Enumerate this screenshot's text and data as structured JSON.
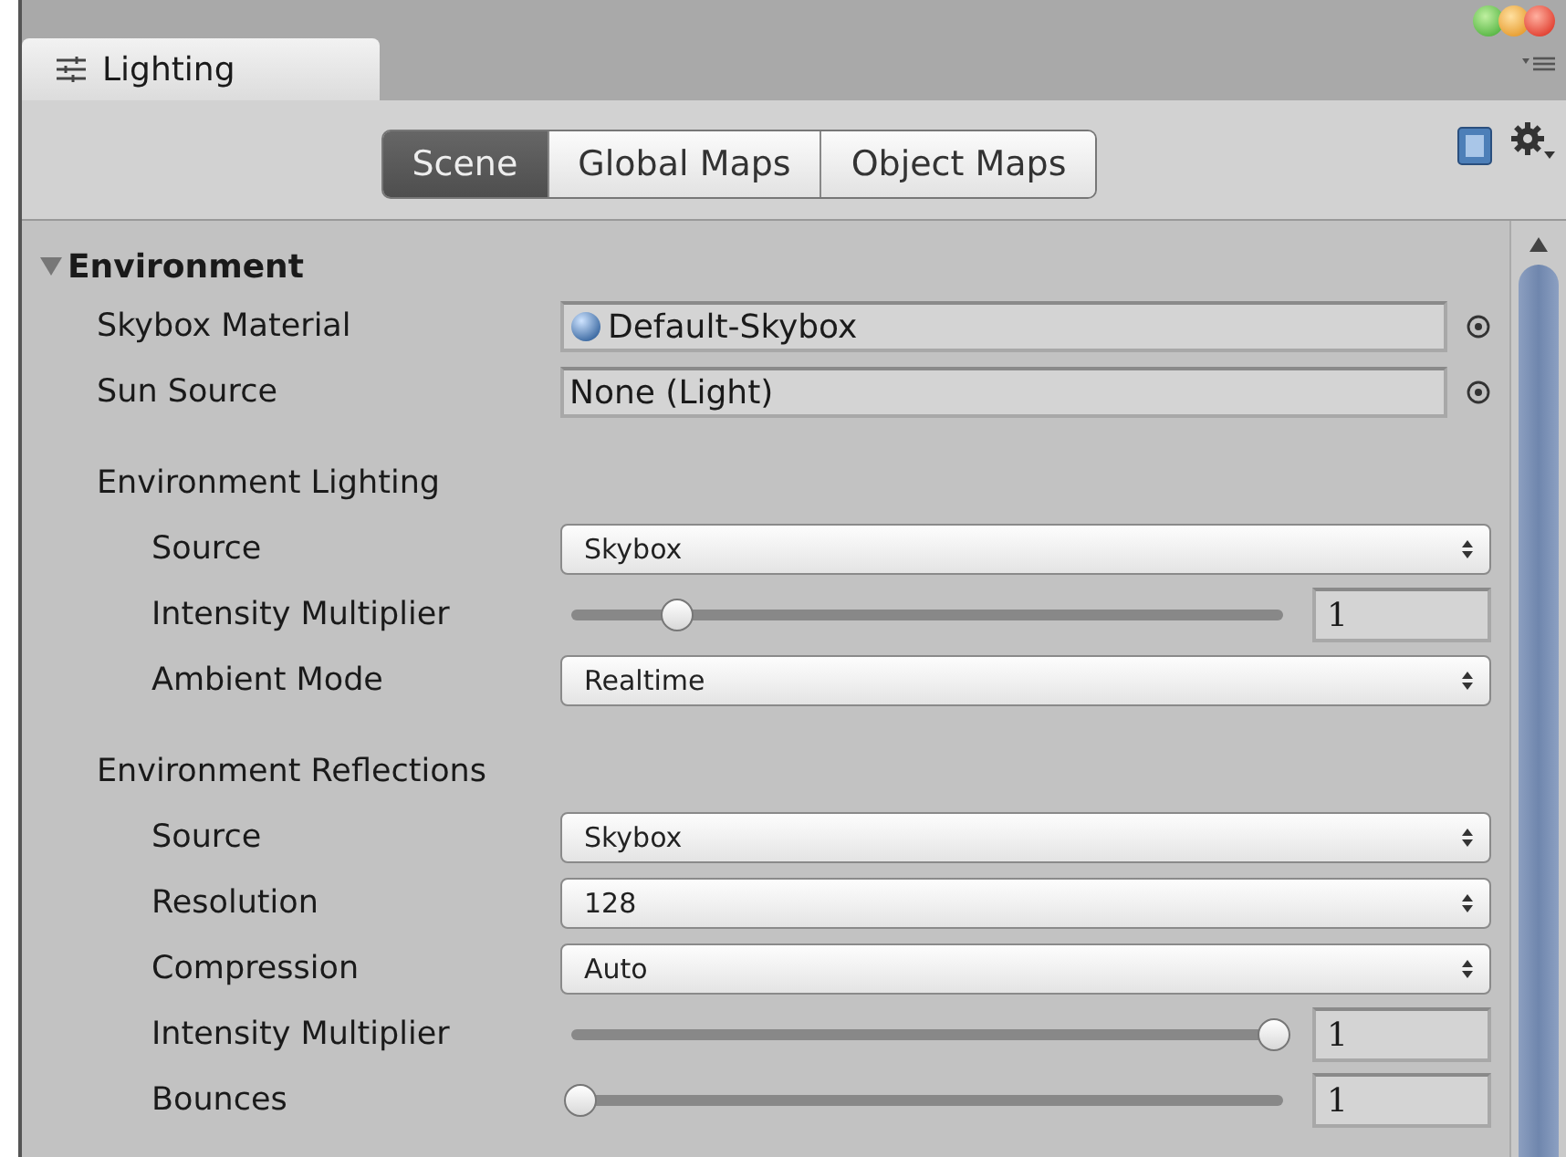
{
  "window": {
    "tab_title": "Lighting"
  },
  "toolbar": {
    "tabs": [
      {
        "label": "Scene",
        "selected": true
      },
      {
        "label": "Global Maps",
        "selected": false
      },
      {
        "label": "Object Maps",
        "selected": false
      }
    ]
  },
  "section": {
    "title": "Environment",
    "expanded": true,
    "rows": [
      {
        "kind": "object",
        "label": "Skybox Material",
        "value": "Default-Skybox",
        "has_icon": true
      },
      {
        "kind": "object",
        "label": "Sun Source",
        "value": "None (Light)",
        "has_icon": false
      }
    ],
    "groups": [
      {
        "title": "Environment Lighting",
        "rows": [
          {
            "kind": "dropdown",
            "label": "Source",
            "value": "Skybox"
          },
          {
            "kind": "slider",
            "label": "Intensity Multiplier",
            "level": 0.14,
            "value": "1"
          },
          {
            "kind": "dropdown",
            "label": "Ambient Mode",
            "value": "Realtime"
          }
        ]
      },
      {
        "title": "Environment Reflections",
        "rows": [
          {
            "kind": "dropdown",
            "label": "Source",
            "value": "Skybox"
          },
          {
            "kind": "dropdown",
            "label": "Resolution",
            "value": "128"
          },
          {
            "kind": "dropdown",
            "label": "Compression",
            "value": "Auto"
          },
          {
            "kind": "slider",
            "label": "Intensity Multiplier",
            "level": 1,
            "value": "1"
          },
          {
            "kind": "slider",
            "label": "Bounces",
            "level": 0,
            "value": "1"
          }
        ]
      }
    ]
  }
}
